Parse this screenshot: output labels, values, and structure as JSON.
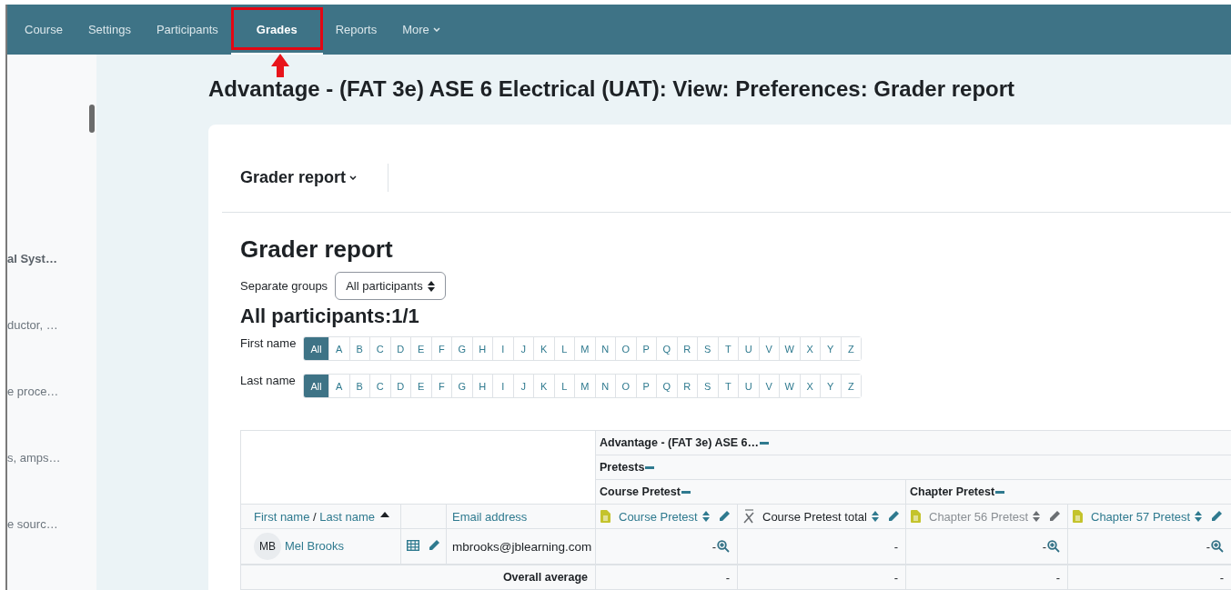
{
  "nav": {
    "items": [
      {
        "label": "Course",
        "kind": "link",
        "selected": false,
        "highlighted": false
      },
      {
        "label": "Settings",
        "kind": "link",
        "selected": false,
        "highlighted": false
      },
      {
        "label": "Participants",
        "kind": "link",
        "selected": false,
        "highlighted": false
      },
      {
        "label": "Grades",
        "kind": "link",
        "selected": true,
        "highlighted": true
      },
      {
        "label": "Reports",
        "kind": "link",
        "selected": false,
        "highlighted": false
      },
      {
        "label": "More",
        "kind": "dropdown",
        "selected": false,
        "highlighted": false
      }
    ]
  },
  "sidebar": {
    "items": [
      {
        "text": "al Syst…",
        "kind": "section"
      },
      {
        "text": "ductor, …",
        "kind": "activity"
      },
      {
        "text": "e proce…",
        "kind": "activity"
      },
      {
        "text": "s, amps…",
        "kind": "activity"
      },
      {
        "text": "e sourc…",
        "kind": "activity"
      }
    ]
  },
  "page": {
    "title": "Advantage - (FAT 3e) ASE 6 Electrical (UAT): View: Preferences: Grader report"
  },
  "report_selector": "Grader report",
  "heading": "Grader report",
  "group_filter": {
    "label": "Separate groups",
    "value": "All participants"
  },
  "participants_heading": "All participants:1/1",
  "initials_bars": [
    {
      "label": "First name",
      "letters": [
        {
          "text": "All",
          "selected": true
        },
        {
          "text": "A",
          "selected": false
        },
        {
          "text": "B",
          "selected": false
        },
        {
          "text": "C",
          "selected": false
        },
        {
          "text": "D",
          "selected": false
        },
        {
          "text": "E",
          "selected": false
        },
        {
          "text": "F",
          "selected": false
        },
        {
          "text": "G",
          "selected": false
        },
        {
          "text": "H",
          "selected": false
        },
        {
          "text": "I",
          "selected": false
        },
        {
          "text": "J",
          "selected": false
        },
        {
          "text": "K",
          "selected": false
        },
        {
          "text": "L",
          "selected": false
        },
        {
          "text": "M",
          "selected": false
        },
        {
          "text": "N",
          "selected": false
        },
        {
          "text": "O",
          "selected": false
        },
        {
          "text": "P",
          "selected": false
        },
        {
          "text": "Q",
          "selected": false
        },
        {
          "text": "R",
          "selected": false
        },
        {
          "text": "S",
          "selected": false
        },
        {
          "text": "T",
          "selected": false
        },
        {
          "text": "U",
          "selected": false
        },
        {
          "text": "V",
          "selected": false
        },
        {
          "text": "W",
          "selected": false
        },
        {
          "text": "X",
          "selected": false
        },
        {
          "text": "Y",
          "selected": false
        },
        {
          "text": "Z",
          "selected": false
        }
      ]
    },
    {
      "label": "Last name",
      "letters": [
        {
          "text": "All",
          "selected": true
        },
        {
          "text": "A",
          "selected": false
        },
        {
          "text": "B",
          "selected": false
        },
        {
          "text": "C",
          "selected": false
        },
        {
          "text": "D",
          "selected": false
        },
        {
          "text": "E",
          "selected": false
        },
        {
          "text": "F",
          "selected": false
        },
        {
          "text": "G",
          "selected": false
        },
        {
          "text": "H",
          "selected": false
        },
        {
          "text": "I",
          "selected": false
        },
        {
          "text": "J",
          "selected": false
        },
        {
          "text": "K",
          "selected": false
        },
        {
          "text": "L",
          "selected": false
        },
        {
          "text": "M",
          "selected": false
        },
        {
          "text": "N",
          "selected": false
        },
        {
          "text": "O",
          "selected": false
        },
        {
          "text": "P",
          "selected": false
        },
        {
          "text": "Q",
          "selected": false
        },
        {
          "text": "R",
          "selected": false
        },
        {
          "text": "S",
          "selected": false
        },
        {
          "text": "T",
          "selected": false
        },
        {
          "text": "U",
          "selected": false
        },
        {
          "text": "V",
          "selected": false
        },
        {
          "text": "W",
          "selected": false
        },
        {
          "text": "X",
          "selected": false
        },
        {
          "text": "Y",
          "selected": false
        },
        {
          "text": "Z",
          "selected": false
        }
      ]
    }
  ],
  "grader_table": {
    "course": {
      "label": "Advantage - (FAT 3e) ASE 6…",
      "expanded": true
    },
    "category": {
      "label": "Pretests",
      "expanded": true
    },
    "groups": [
      {
        "label": "Course Pretest",
        "expanded": true,
        "items": [
          {
            "label": "Course Pretest",
            "kind": "activity",
            "hidden": false
          },
          {
            "label": "Course Pretest total",
            "kind": "total",
            "hidden": false
          }
        ]
      },
      {
        "label": "Chapter Pretest",
        "expanded": true,
        "items": [
          {
            "label": "Chapter 56 Pretest",
            "kind": "activity",
            "hidden": true
          },
          {
            "label": "Chapter 57 Pretest",
            "kind": "activity",
            "hidden": false
          }
        ]
      }
    ],
    "headers": {
      "first_name": "First name",
      "separator": "/",
      "last_name": "Last name",
      "sort_ascending": true,
      "email": "Email address"
    },
    "students": [
      {
        "initials": "MB",
        "name": "Mel Brooks",
        "email": "mbrooks@jblearning.com",
        "grades": [
          "-",
          "-",
          "-",
          "-"
        ]
      }
    ],
    "overall": {
      "label": "Overall average",
      "values": [
        "-",
        "-",
        "-",
        "-"
      ]
    }
  }
}
